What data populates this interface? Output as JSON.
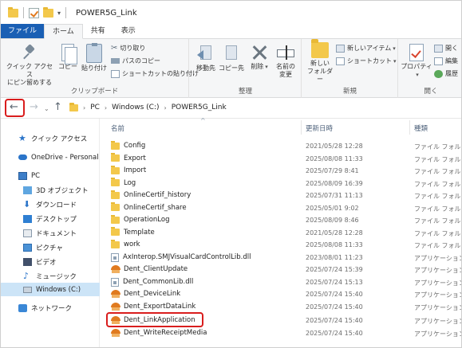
{
  "window": {
    "title": "POWER5G_Link"
  },
  "ribbon_tabs": [
    "ファイル",
    "ホーム",
    "共有",
    "表示"
  ],
  "ribbon": {
    "clipboard": {
      "pin_label_1": "クイック アクセス",
      "pin_label_2": "にピン留めする",
      "copy_label": "コピー",
      "paste_label": "貼り付け",
      "cut_label": "切り取り",
      "copy_path_label": "パスのコピー",
      "paste_shortcut_label": "ショートカットの貼り付け",
      "group_label": "クリップボード"
    },
    "organize": {
      "move_label": "移動先",
      "copy_to_label": "コピー先",
      "delete_label": "削除",
      "rename_label_1": "名前の",
      "rename_label_2": "変更",
      "group_label": "整理"
    },
    "new": {
      "new_item_label": "新しいアイテム",
      "shortcut_label": "ショートカット",
      "new_folder_label_1": "新しい",
      "new_folder_label_2": "フォルダー",
      "group_label": "新規"
    },
    "open": {
      "properties_label": "プロパティ",
      "open_label": "開く",
      "edit_label": "編集",
      "history_label": "履歴",
      "group_label": "開く"
    }
  },
  "address": {
    "breadcrumbs": [
      "PC",
      "Windows (C:)",
      "POWER5G_Link"
    ]
  },
  "nav_pane": {
    "items": [
      {
        "label": "クイック アクセス",
        "icon": "star-icon"
      },
      {
        "label": "OneDrive - Personal",
        "icon": "cloud-icon"
      },
      {
        "label": "PC",
        "icon": "pc-icon"
      },
      {
        "label": "3D オブジェクト",
        "icon": "cube-icon"
      },
      {
        "label": "ダウンロード",
        "icon": "download-icon"
      },
      {
        "label": "デスクトップ",
        "icon": "desktop-icon"
      },
      {
        "label": "ドキュメント",
        "icon": "document-icon"
      },
      {
        "label": "ピクチャ",
        "icon": "picture-icon"
      },
      {
        "label": "ビデオ",
        "icon": "video-icon"
      },
      {
        "label": "ミュージック",
        "icon": "music-icon"
      },
      {
        "label": "Windows (C:)",
        "icon": "drive-icon"
      },
      {
        "label": "ネットワーク",
        "icon": "network-icon"
      }
    ]
  },
  "file_list": {
    "columns": {
      "name": "名前",
      "date": "更新日時",
      "type": "種類"
    },
    "rows": [
      {
        "name": "Config",
        "date": "2021/05/28 12:28",
        "type": "ファイル フォルダー",
        "kind": "folder"
      },
      {
        "name": "Export",
        "date": "2025/08/08 11:33",
        "type": "ファイル フォルダー",
        "kind": "folder"
      },
      {
        "name": "Import",
        "date": "2025/07/29 8:41",
        "type": "ファイル フォルダー",
        "kind": "folder"
      },
      {
        "name": "Log",
        "date": "2025/08/09 16:39",
        "type": "ファイル フォルダー",
        "kind": "folder"
      },
      {
        "name": "OnlineCertif_history",
        "date": "2025/07/31 11:13",
        "type": "ファイル フォルダー",
        "kind": "folder"
      },
      {
        "name": "OnlineCertif_share",
        "date": "2025/05/01 9:02",
        "type": "ファイル フォルダー",
        "kind": "folder"
      },
      {
        "name": "OperationLog",
        "date": "2025/08/09 8:46",
        "type": "ファイル フォルダー",
        "kind": "folder"
      },
      {
        "name": "Template",
        "date": "2021/05/28 12:28",
        "type": "ファイル フォルダー",
        "kind": "folder"
      },
      {
        "name": "work",
        "date": "2025/08/08 11:33",
        "type": "ファイル フォルダー",
        "kind": "folder"
      },
      {
        "name": "AxInterop.SMJVisualCardControlLib.dll",
        "date": "2023/08/01 11:23",
        "type": "アプリケーション拡張",
        "kind": "dll"
      },
      {
        "name": "Dent_ClientUpdate",
        "date": "2025/07/24 15:39",
        "type": "アプリケーション",
        "kind": "app"
      },
      {
        "name": "Dent_CommonLib.dll",
        "date": "2025/07/24 15:13",
        "type": "アプリケーション拡張",
        "kind": "dll"
      },
      {
        "name": "Dent_DeviceLink",
        "date": "2025/07/24 15:40",
        "type": "アプリケーション",
        "kind": "app"
      },
      {
        "name": "Dent_ExportDataLink",
        "date": "2025/07/24 15:40",
        "type": "アプリケーション",
        "kind": "app"
      },
      {
        "name": "Dent_LinkApplication",
        "date": "2025/07/24 15:40",
        "type": "アプリケーション",
        "kind": "app"
      },
      {
        "name": "Dent_WriteReceiptMedia",
        "date": "2025/07/24 15:40",
        "type": "アプリケーション",
        "kind": "app"
      }
    ]
  },
  "colors": {
    "highlight": "#d91d1d",
    "file_tab": "#1a5fb4",
    "selected_nav": "#cce4f7"
  }
}
